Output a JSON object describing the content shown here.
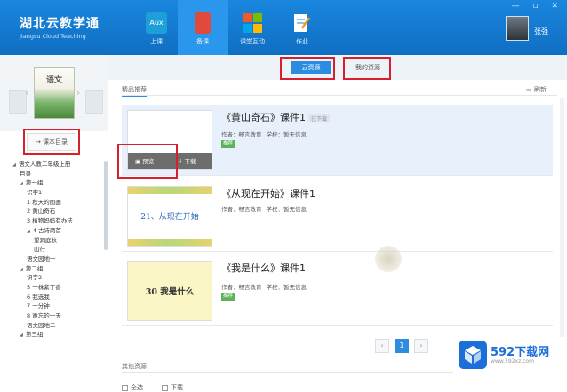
{
  "header": {
    "brand_cn": "湖北云教学通",
    "brand_en": "Jiangsu Cloud Teaching",
    "username": "张强",
    "window_controls": "— ▫ ✕",
    "nav": [
      {
        "label": "上课",
        "icon": "aux-icon",
        "color": "#1d9fd8"
      },
      {
        "label": "备课",
        "icon": "book-icon",
        "color": "#e04a3c"
      },
      {
        "label": "课堂互动",
        "icon": "windows-icon",
        "color": "#f0a020"
      },
      {
        "label": "作业",
        "icon": "pencil-note-icon",
        "color": "#ffffff"
      }
    ]
  },
  "sidebar": {
    "book_title": "语文",
    "catalog_label": "→ 课本目录",
    "tree": [
      {
        "t": "语文人教二年级上册",
        "lvl": 0,
        "tog": true
      },
      {
        "t": "目录",
        "lvl": 1
      },
      {
        "t": "第一组",
        "lvl": 1,
        "tog": true
      },
      {
        "t": "识字1",
        "lvl": 2
      },
      {
        "t": "1 秋天的图画",
        "lvl": 2
      },
      {
        "t": "2 黄山奇石",
        "lvl": 2
      },
      {
        "t": "3 植物妈妈有办法",
        "lvl": 2
      },
      {
        "t": "4 古诗两首",
        "lvl": 2,
        "tog": true
      },
      {
        "t": "望洞庭秋",
        "lvl": 3
      },
      {
        "t": "山行",
        "lvl": 3
      },
      {
        "t": "语文园地一",
        "lvl": 2
      },
      {
        "t": "第二组",
        "lvl": 1,
        "tog": true
      },
      {
        "t": "识字2",
        "lvl": 2
      },
      {
        "t": "5 一株紫丁香",
        "lvl": 2
      },
      {
        "t": "6 我选我",
        "lvl": 2
      },
      {
        "t": "7 一分钟",
        "lvl": 2
      },
      {
        "t": "8 难忘的一天",
        "lvl": 2
      },
      {
        "t": "语文园地二",
        "lvl": 2
      },
      {
        "t": "第三组",
        "lvl": 1,
        "tog": true
      }
    ]
  },
  "main": {
    "tab_cloud": "云资源",
    "tab_mine": "我的资源",
    "section_title": "精品推荐",
    "refresh": "刷新",
    "cards": [
      {
        "title": "《黄山奇石》课件1",
        "badge": "已下载",
        "author": "作者：畅言教育",
        "school": "学校：暂无信息",
        "tag": "推荐",
        "thumb": ""
      },
      {
        "title": "《从现在开始》课件1",
        "author": "作者：畅言教育",
        "school": "学校：暂无信息",
        "thumb": "21、从现在开始"
      },
      {
        "title": "《我是什么》课件1",
        "author": "作者：畅言教育",
        "school": "学校：暂无信息",
        "tag": "推荐",
        "thumb": "30  我是什么"
      }
    ],
    "preview_label": "预览",
    "download_label": "下载",
    "pager": {
      "prev": "‹",
      "current": "1",
      "next": "›"
    },
    "other_title": "其他资源",
    "select_all": "全选",
    "download_check": "下载"
  },
  "watermark": {
    "title": "592下载网",
    "url": "www.592xz.com"
  }
}
